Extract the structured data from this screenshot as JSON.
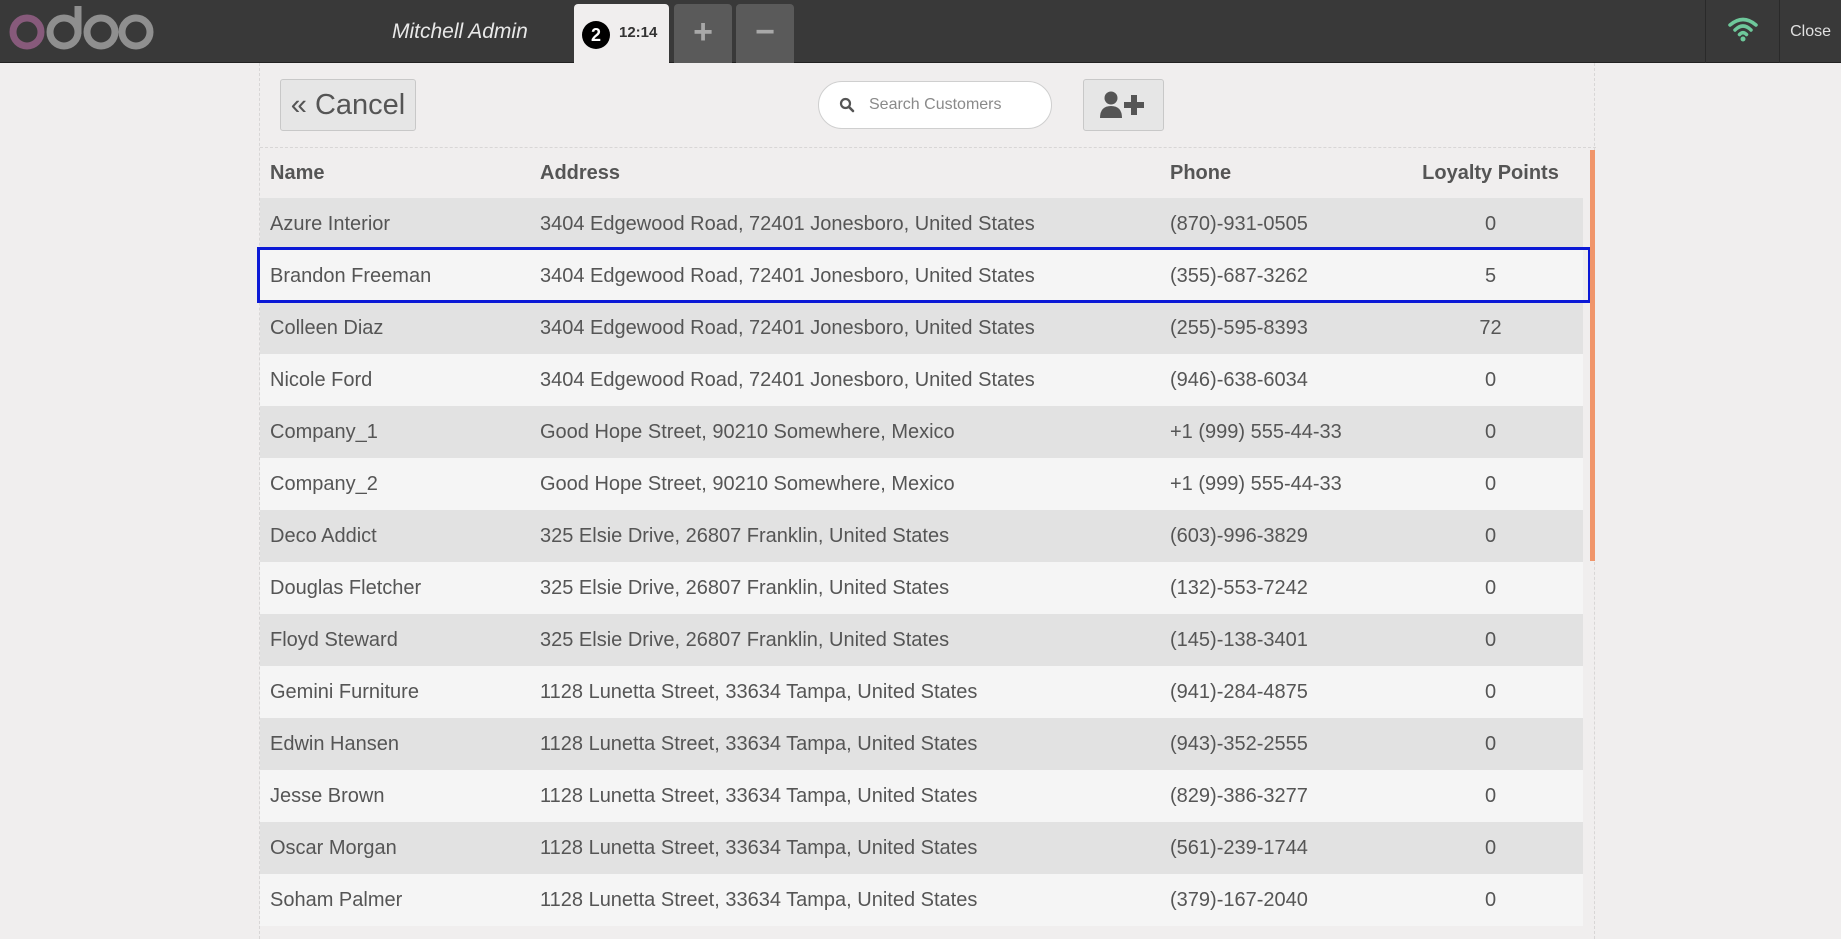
{
  "topbar": {
    "logo_text": "odoo",
    "cashier": "Mitchell Admin",
    "order": {
      "number": "2",
      "time": "12:14"
    },
    "add_order_label": "+",
    "remove_order_label": "−",
    "close_label": "Close",
    "colors": {
      "bar": "#393939",
      "logo_o": "#875a7b",
      "logo_rest": "#8f8f8f",
      "wifi": "#6ec89b"
    }
  },
  "controls": {
    "cancel_label": "« Cancel",
    "search_placeholder": "Search Customers",
    "new_customer_icon": "user-plus-icon"
  },
  "table": {
    "headers": {
      "name": "Name",
      "address": "Address",
      "phone": "Phone",
      "points": "Loyalty Points"
    },
    "selected_index": 1,
    "rows": [
      {
        "name": "Azure Interior",
        "address": "3404 Edgewood Road, 72401 Jonesboro, United States",
        "phone": "(870)-931-0505",
        "points": "0"
      },
      {
        "name": "Brandon Freeman",
        "address": "3404 Edgewood Road, 72401 Jonesboro, United States",
        "phone": "(355)-687-3262",
        "points": "5"
      },
      {
        "name": "Colleen Diaz",
        "address": "3404 Edgewood Road, 72401 Jonesboro, United States",
        "phone": "(255)-595-8393",
        "points": "72"
      },
      {
        "name": "Nicole Ford",
        "address": "3404 Edgewood Road, 72401 Jonesboro, United States",
        "phone": "(946)-638-6034",
        "points": "0"
      },
      {
        "name": "Company_1",
        "address": "Good Hope Street, 90210 Somewhere, Mexico",
        "phone": "+1 (999) 555-44-33",
        "points": "0"
      },
      {
        "name": "Company_2",
        "address": "Good Hope Street, 90210 Somewhere, Mexico",
        "phone": "+1 (999) 555-44-33",
        "points": "0"
      },
      {
        "name": "Deco Addict",
        "address": "325 Elsie Drive, 26807 Franklin, United States",
        "phone": "(603)-996-3829",
        "points": "0"
      },
      {
        "name": "Douglas Fletcher",
        "address": "325 Elsie Drive, 26807 Franklin, United States",
        "phone": "(132)-553-7242",
        "points": "0"
      },
      {
        "name": "Floyd Steward",
        "address": "325 Elsie Drive, 26807 Franklin, United States",
        "phone": "(145)-138-3401",
        "points": "0"
      },
      {
        "name": "Gemini Furniture",
        "address": "1128 Lunetta Street, 33634 Tampa, United States",
        "phone": "(941)-284-4875",
        "points": "0"
      },
      {
        "name": "Edwin Hansen",
        "address": "1128 Lunetta Street, 33634 Tampa, United States",
        "phone": "(943)-352-2555",
        "points": "0"
      },
      {
        "name": "Jesse Brown",
        "address": "1128 Lunetta Street, 33634 Tampa, United States",
        "phone": "(829)-386-3277",
        "points": "0"
      },
      {
        "name": "Oscar Morgan",
        "address": "1128 Lunetta Street, 33634 Tampa, United States",
        "phone": "(561)-239-1744",
        "points": "0"
      },
      {
        "name": "Soham Palmer",
        "address": "1128 Lunetta Street, 33634 Tampa, United States",
        "phone": "(379)-167-2040",
        "points": "0"
      }
    ],
    "colors": {
      "selection_border": "#0b19d6",
      "scroll_thumb": "#f0956a"
    }
  }
}
